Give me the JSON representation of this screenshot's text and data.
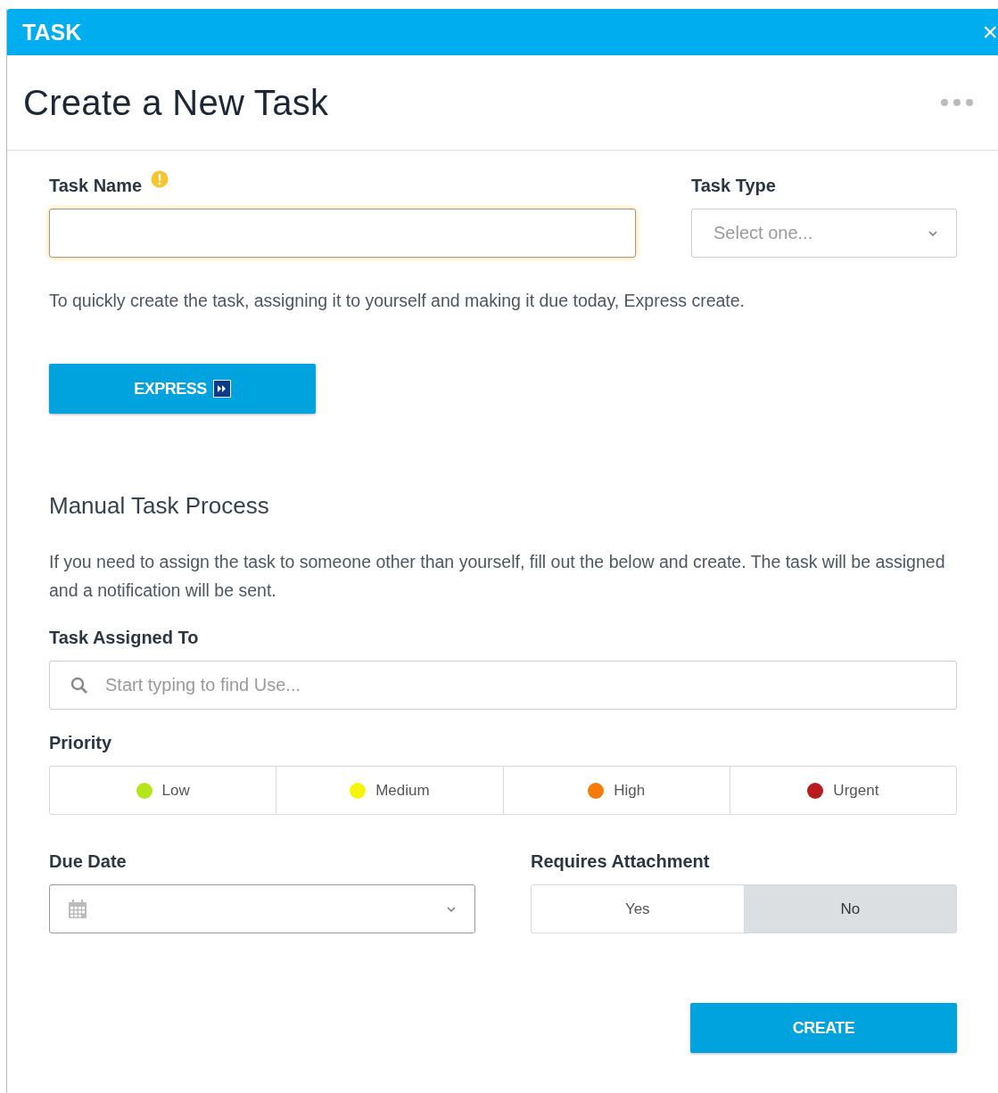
{
  "window": {
    "title": "TASK",
    "close": "×"
  },
  "header": {
    "title": "Create a New Task"
  },
  "task_name": {
    "label": "Task Name",
    "required": true
  },
  "task_type": {
    "label": "Task Type",
    "placeholder": "Select one..."
  },
  "express_note": "To quickly create the task, assigning it to yourself and making it due today, Express create.",
  "express_button": "EXPRESS",
  "manual": {
    "heading": "Manual Task Process",
    "note": "If you need to assign the task to someone other than yourself, fill out the below and create. The task will be assigned and a notification will be sent."
  },
  "assigned_to": {
    "label": "Task Assigned To",
    "placeholder": "Start typing to find Use..."
  },
  "priority": {
    "label": "Priority",
    "options": [
      {
        "label": "Low",
        "color": "#b5e61d",
        "selected": false
      },
      {
        "label": "Medium",
        "color": "#f5f50a",
        "selected": false
      },
      {
        "label": "High",
        "color": "#f57c0a",
        "selected": false
      },
      {
        "label": "Urgent",
        "color": "#b81c1c",
        "selected": false
      }
    ]
  },
  "due_date": {
    "label": "Due Date"
  },
  "requires_attachment": {
    "label": "Requires Attachment",
    "options": [
      {
        "label": "Yes",
        "selected": false
      },
      {
        "label": "No",
        "selected": true
      }
    ]
  },
  "create_button": "CREATE"
}
